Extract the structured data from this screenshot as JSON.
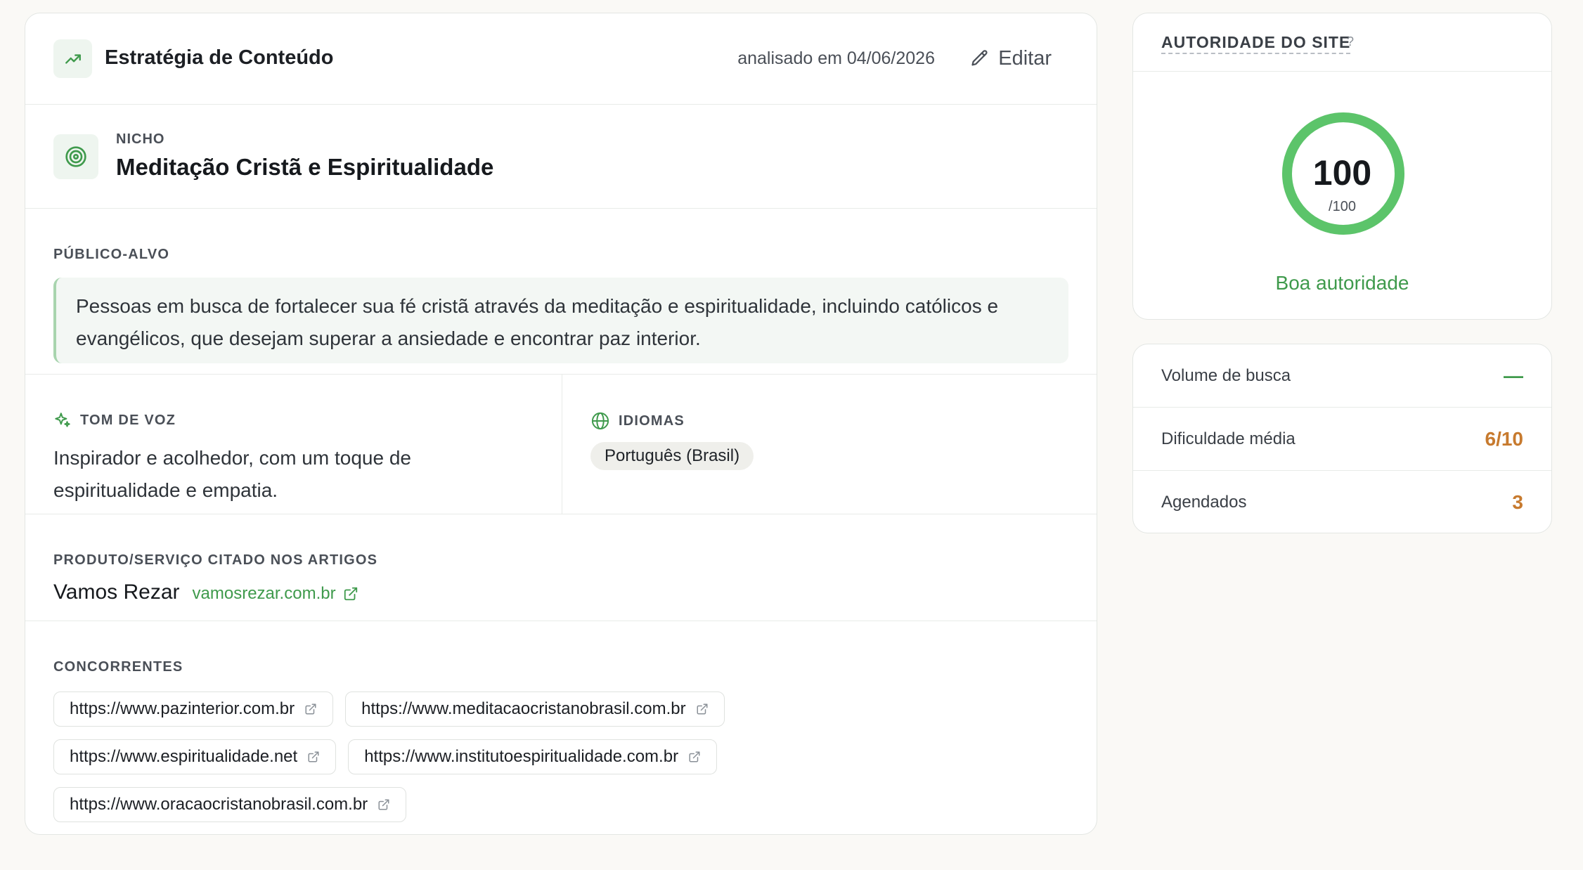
{
  "strategy": {
    "title": "Estratégia de Conteúdo",
    "analysed_date": "analisado em 04/06/2026",
    "edit_label": "Editar"
  },
  "niche": {
    "label": "NICHO",
    "value": "Meditação Cristã e Espiritualidade"
  },
  "audience": {
    "label": "PÚBLICO-ALVO",
    "text": "Pessoas em busca de fortalecer sua fé cristã através da meditação e espiritualidade, incluindo católicos e evangélicos, que desejam superar a ansiedade e encontrar paz interior."
  },
  "tone": {
    "label": "TOM DE VOZ",
    "text": "Inspirador e acolhedor, com um toque de espiritualidade e empatia."
  },
  "languages": {
    "label": "IDIOMAS",
    "items": [
      "Português (Brasil)"
    ]
  },
  "product": {
    "label": "PRODUTO/SERVIÇO CITADO NOS ARTIGOS",
    "name": "Vamos Rezar",
    "link": "vamosrezar.com.br"
  },
  "competitors": {
    "label": "CONCORRENTES",
    "items": [
      "https://www.pazinterior.com.br",
      "https://www.meditacaocristanobrasil.com.br",
      "https://www.espiritualidade.net",
      "https://www.institutoespiritualidade.com.br",
      "https://www.oracaocristanobrasil.com.br"
    ]
  },
  "authority": {
    "title": "AUTORIDADE DO SITE",
    "help": "?",
    "score": "100",
    "score_max": "/100",
    "score_fraction": 1.0,
    "status": "Boa autoridade",
    "color": "#5cc46a"
  },
  "metrics": [
    {
      "label": "Volume de busca",
      "value": "—",
      "color": "#3f9a4c"
    },
    {
      "label": "Dificuldade média",
      "value": "6/10",
      "color": "#c77a2e"
    },
    {
      "label": "Agendados",
      "value": "3",
      "color": "#c77a2e"
    }
  ],
  "icons": {
    "header": "trending-up-icon",
    "niche": "target-icon",
    "tone": "sparkle-icon",
    "languages": "globe-icon",
    "edit": "pencil-icon",
    "external": "external-link-icon"
  },
  "colors": {
    "accent_green": "#3f9a4c",
    "accent_orange": "#c77a2e"
  }
}
